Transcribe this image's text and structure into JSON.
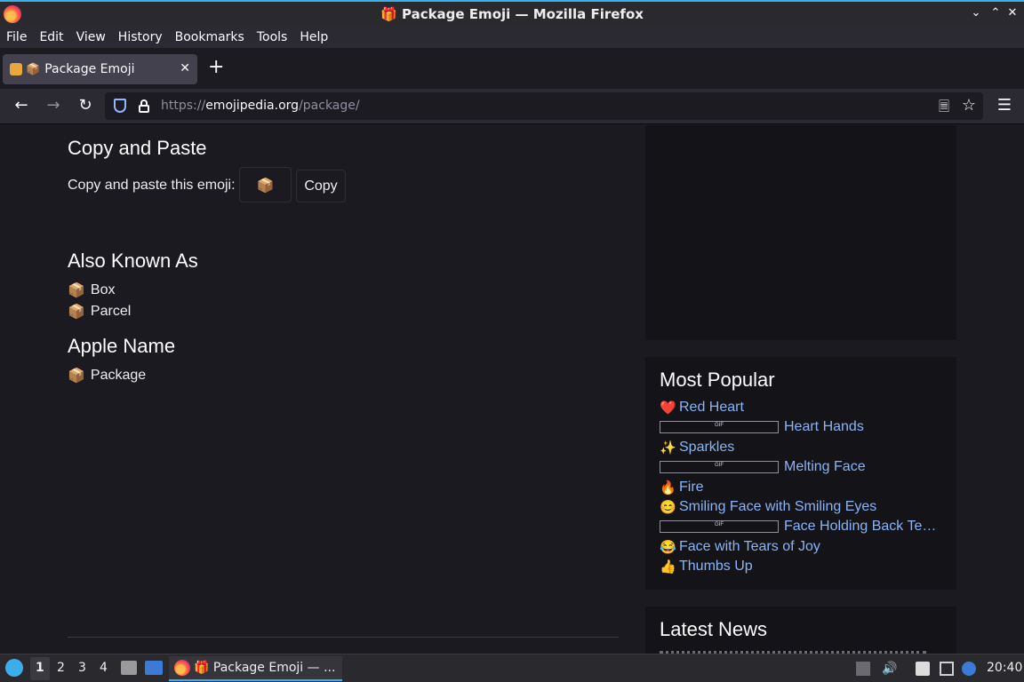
{
  "window": {
    "title": "🎁 Package Emoji — Mozilla Firefox",
    "minimize": "⌄",
    "restore": "⌃",
    "close": "✕"
  },
  "menu": {
    "file": "File",
    "edit": "Edit",
    "view": "View",
    "history": "History",
    "bookmarks": "Bookmarks",
    "tools": "Tools",
    "help": "Help"
  },
  "tab": {
    "favicon_emoji": "📦",
    "label": "Package Emoji",
    "close": "✕",
    "new_tab": "+"
  },
  "nav": {
    "back": "←",
    "forward": "→",
    "reload": "↻",
    "url_prefix": "https://",
    "url_host": "emojipedia.org",
    "url_path": "/package/",
    "reader": "🗏",
    "bookmark": "☆",
    "menu": "☰"
  },
  "content": {
    "copy_heading": "Copy and Paste",
    "copy_prompt": "Copy and paste this emoji:",
    "emoji": "📦",
    "copy_button": "Copy",
    "aka_heading": "Also Known As",
    "aka_items": [
      {
        "emoji": "📦",
        "label": "Box"
      },
      {
        "emoji": "📦",
        "label": "Parcel"
      }
    ],
    "apple_heading": "Apple Name",
    "apple_item": {
      "emoji": "📦",
      "label": "Package"
    }
  },
  "sidebar": {
    "popular_heading": "Most Popular",
    "popular": [
      {
        "emoji": "❤️",
        "label": "Red Heart",
        "gif": false
      },
      {
        "emoji": "",
        "label": "Heart Hands",
        "gif": true
      },
      {
        "emoji": "✨",
        "label": "Sparkles",
        "gif": false
      },
      {
        "emoji": "",
        "label": "Melting Face",
        "gif": true
      },
      {
        "emoji": "🔥",
        "label": "Fire",
        "gif": false
      },
      {
        "emoji": "😊",
        "label": "Smiling Face with Smiling Eyes",
        "gif": false
      },
      {
        "emoji": "",
        "label": "Face Holding Back Te…",
        "gif": true
      },
      {
        "emoji": "😂",
        "label": "Face with Tears of Joy",
        "gif": false
      },
      {
        "emoji": "👍",
        "label": "Thumbs Up",
        "gif": false
      }
    ],
    "news_heading": "Latest News"
  },
  "taskbar": {
    "workspaces": [
      "1",
      "2",
      "3",
      "4"
    ],
    "task_label": "🎁 Package Emoji — ...",
    "clock": "20:40"
  }
}
